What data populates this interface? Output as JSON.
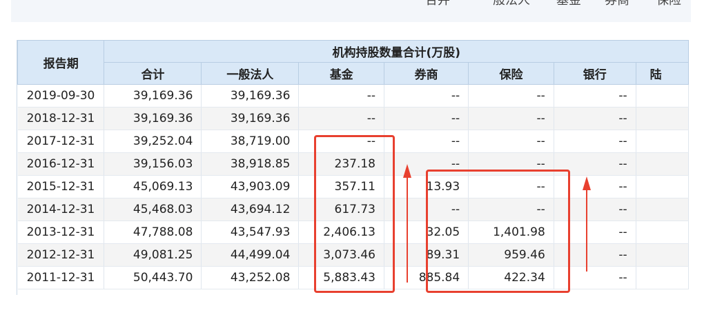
{
  "top_tabs": [
    "合并",
    "一般法人",
    "基金",
    "券商",
    "保险"
  ],
  "table": {
    "period_header": "报告期",
    "group_header": "机构持股数量合计(万股)",
    "columns": [
      "合计",
      "一般法人",
      "基金",
      "券商",
      "保险",
      "银行",
      "陆"
    ],
    "rows": [
      {
        "date": "2019-09-30",
        "values": [
          "39,169.36",
          "39,169.36",
          "--",
          "--",
          "--",
          "--",
          ""
        ]
      },
      {
        "date": "2018-12-31",
        "values": [
          "39,169.36",
          "39,169.36",
          "--",
          "--",
          "--",
          "--",
          ""
        ]
      },
      {
        "date": "2017-12-31",
        "values": [
          "39,252.04",
          "38,719.00",
          "--",
          "--",
          "--",
          "--",
          ""
        ]
      },
      {
        "date": "2016-12-31",
        "values": [
          "39,156.03",
          "38,918.85",
          "237.18",
          "--",
          "--",
          "--",
          ""
        ]
      },
      {
        "date": "2015-12-31",
        "values": [
          "45,069.13",
          "43,903.09",
          "357.11",
          "13.93",
          "--",
          "--",
          ""
        ]
      },
      {
        "date": "2014-12-31",
        "values": [
          "45,468.03",
          "43,694.12",
          "617.73",
          "--",
          "--",
          "--",
          ""
        ]
      },
      {
        "date": "2013-12-31",
        "values": [
          "47,788.08",
          "43,547.93",
          "2,406.13",
          "32.05",
          "1,401.98",
          "--",
          ""
        ]
      },
      {
        "date": "2012-12-31",
        "values": [
          "49,081.25",
          "44,499.04",
          "3,073.46",
          "89.31",
          "959.46",
          "--",
          ""
        ]
      },
      {
        "date": "2011-12-31",
        "values": [
          "50,443.70",
          "43,252.08",
          "5,883.43",
          "885.84",
          "422.34",
          "--",
          ""
        ]
      }
    ]
  },
  "annotation_color": "#e8402f"
}
